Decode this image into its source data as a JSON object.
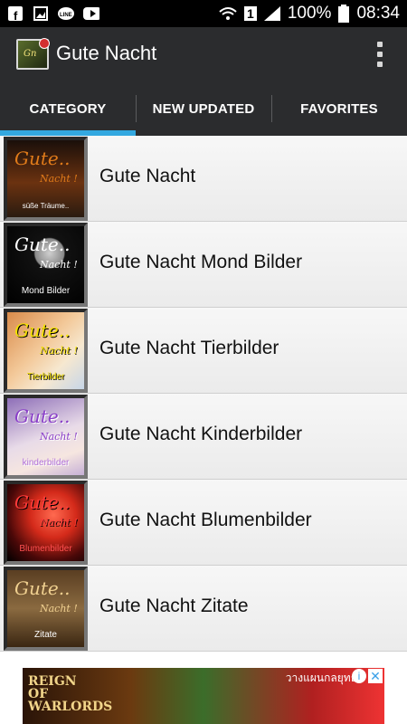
{
  "status_bar": {
    "icons_left": [
      "facebook-icon",
      "image-icon",
      "line-icon",
      "youtube-icon"
    ],
    "sim_label": "1",
    "battery": "100%",
    "time": "08:34"
  },
  "app_bar": {
    "title": "Gute Nacht",
    "overflow_icon": "more-vert-icon"
  },
  "tabs": [
    {
      "label": "CATEGORY",
      "active": true
    },
    {
      "label": "NEW UPDATED",
      "active": false
    },
    {
      "label": "FAVORITES",
      "active": false
    }
  ],
  "categories": [
    {
      "label": "Gute Nacht",
      "thumb_caption": "süße Träume..",
      "thumb_color": "#e07b1a"
    },
    {
      "label": "Gute Nacht Mond Bilder",
      "thumb_caption": "Mond Bilder",
      "thumb_color": "#ffffff"
    },
    {
      "label": "Gute Nacht Tierbilder",
      "thumb_caption": "Tierbilder",
      "thumb_color": "#f4e000"
    },
    {
      "label": "Gute Nacht Kinderbilder",
      "thumb_caption": "kinderbilder",
      "thumb_color": "#b06fd8"
    },
    {
      "label": "Gute Nacht Blumenbilder",
      "thumb_caption": "Blumenbilder",
      "thumb_color": "#ff4040"
    },
    {
      "label": "Gute Nacht Zitate",
      "thumb_caption": "Zitate",
      "thumb_color": "#e8c070"
    }
  ],
  "thumb_script": {
    "line1": "Gute..",
    "line2": "Nacht !"
  },
  "ad": {
    "logo_text": "REIGN OF WARLORDS",
    "thai_text": "วางแผนกลยุทธ",
    "close_icon": "close-icon",
    "info_icon": "info-icon"
  },
  "colors": {
    "app_bar": "#2b2c2e",
    "tab_indicator": "#33a8e0",
    "status_bar": "#000000"
  }
}
